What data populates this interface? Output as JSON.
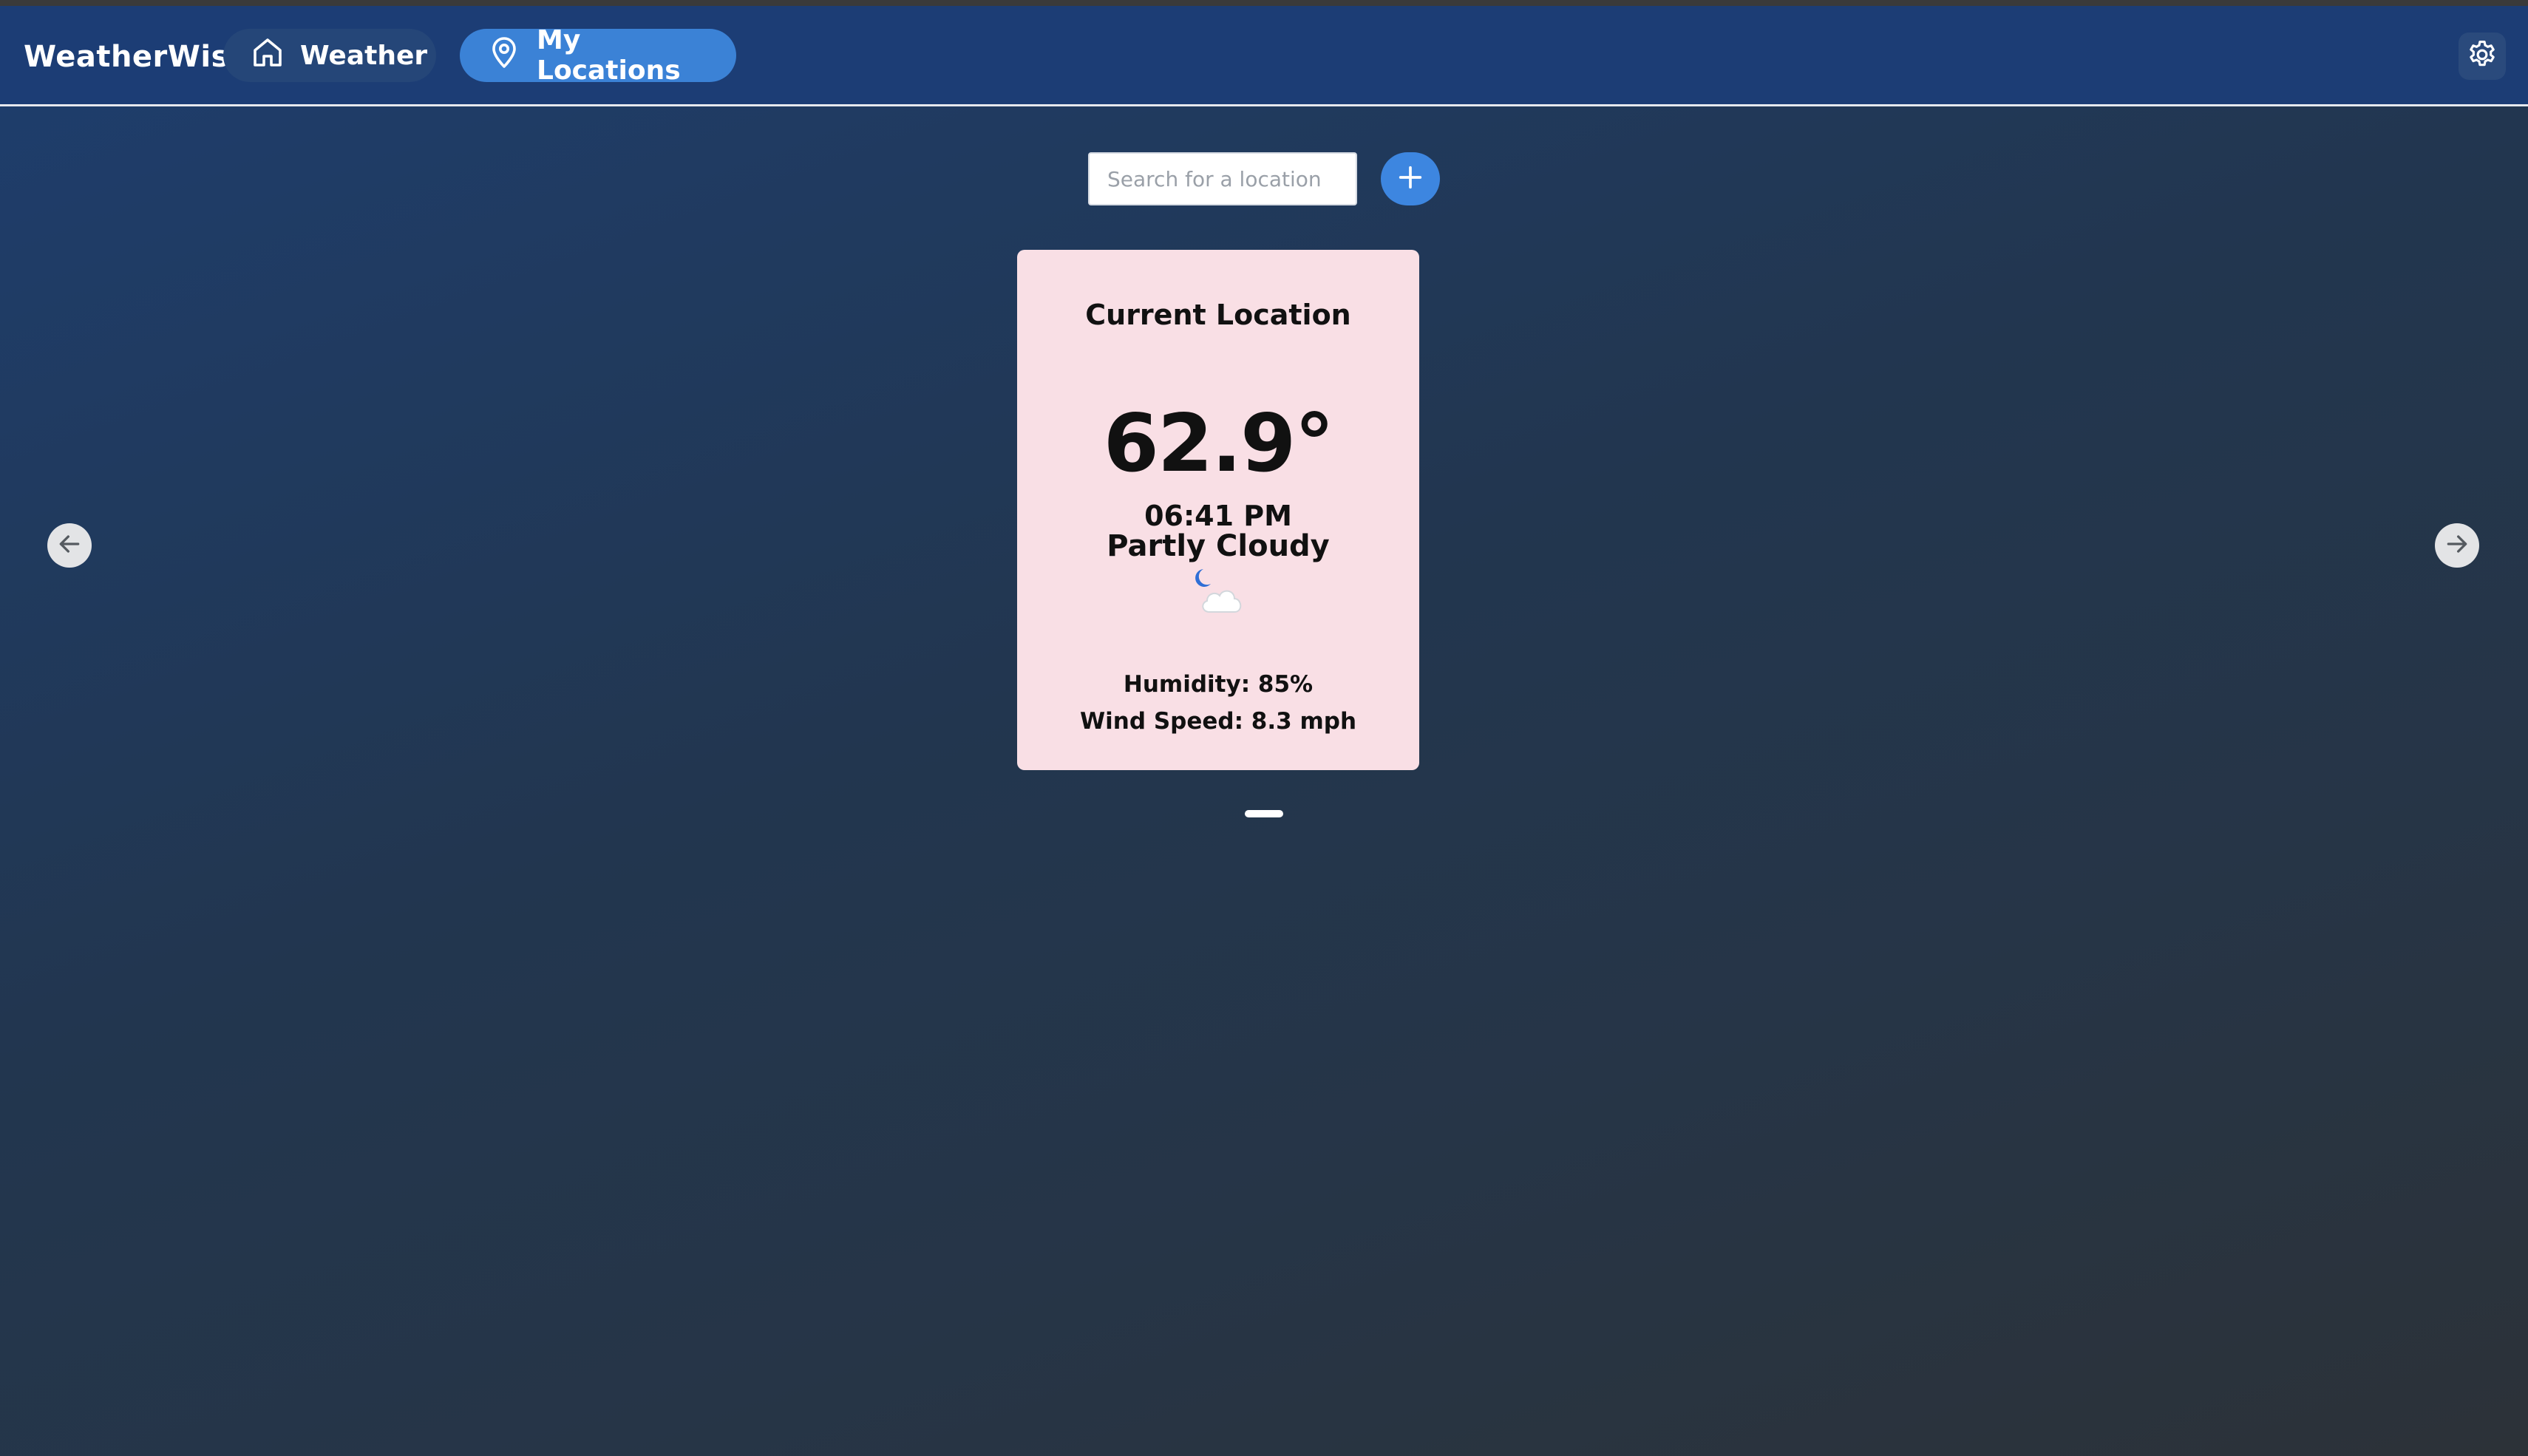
{
  "app": {
    "brand": "WeatherWise"
  },
  "nav": {
    "weather_label": "Weather",
    "locations_label": "My Locations",
    "active": "My Locations"
  },
  "search": {
    "placeholder": "Search for a location",
    "value": ""
  },
  "card": {
    "title": "Current Location",
    "temperature": "62.9°",
    "time": "06:41 PM",
    "condition": "Partly Cloudy",
    "icon": "moon-cloud-icon",
    "humidity": "Humidity: 85%",
    "wind": "Wind Speed: 8.3 mph"
  },
  "carousel": {
    "page": 1,
    "total": 1
  },
  "icons": {
    "nav_weather": "home-icon",
    "nav_locations": "map-pin-icon",
    "settings": "gear-icon",
    "add": "plus-icon",
    "prev": "arrow-left-icon",
    "next": "arrow-right-icon"
  },
  "colors": {
    "navbar": "#1c3d75",
    "active_nav": "#3b82d6",
    "add_button": "#3d86e0",
    "card_bg": "#f9dfe5"
  }
}
